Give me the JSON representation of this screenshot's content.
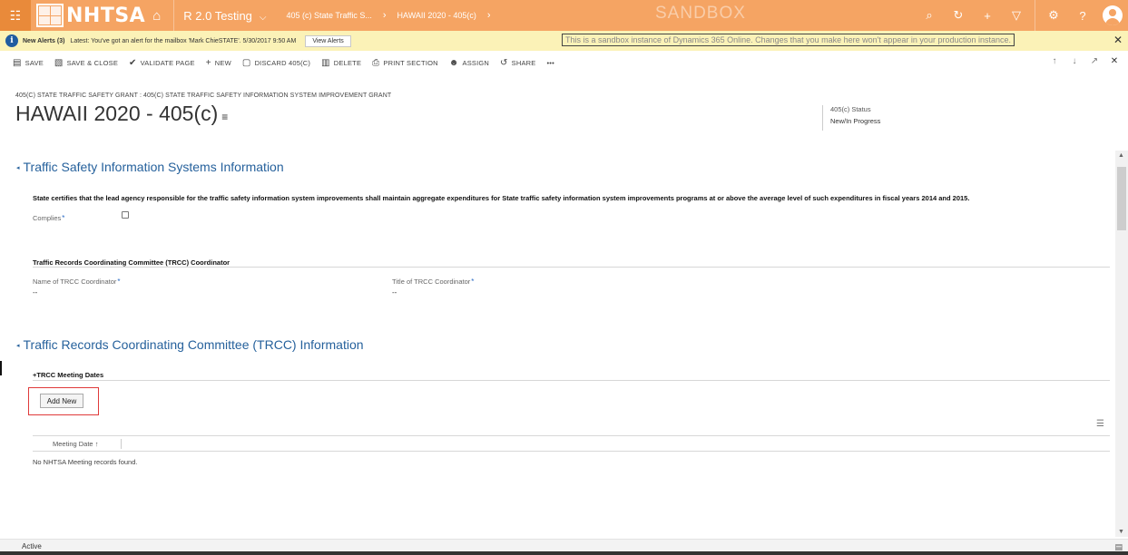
{
  "topnav": {
    "logo_text": "NHTSA",
    "environment": "R 2.0 Testing",
    "breadcrumb_1": "405 (c) State Traffic S...",
    "breadcrumb_2": "HAWAII 2020 - 405(c)",
    "sandbox_label": "SANDBOX"
  },
  "alert": {
    "title": "New Alerts (3)",
    "message": "Latest: You've got an alert for the mailbox 'Mark ChieSTATE'. 5/30/2017 9:50 AM",
    "view_label": "View Alerts",
    "sandbox_notice": "This is a sandbox instance of Dynamics 365 Online.  Changes that you make here won't appear in your production instance."
  },
  "commands": {
    "save": "SAVE",
    "save_close": "SAVE & CLOSE",
    "validate": "VALIDATE PAGE",
    "new": "NEW",
    "discard": "DISCARD 405(C)",
    "delete": "DELETE",
    "print": "PRINT SECTION",
    "assign": "ASSIGN",
    "share": "SHARE",
    "more": "•••"
  },
  "header": {
    "breadcrumb": "405(C) STATE TRAFFIC SAFETY GRANT : 405(C) STATE TRAFFIC SAFETY INFORMATION SYSTEM IMPROVEMENT GRANT",
    "title": "HAWAII 2020 - 405(c)",
    "status_label": "405(c) Status",
    "status_value": "New/In Progress"
  },
  "section1": {
    "title": "Traffic Safety Information Systems Information",
    "certification": "State certifies that the lead agency responsible for the traffic safety information system improvements shall maintain aggregate expenditures for State traffic safety information system improvements programs at or above the average level of such expenditures in fiscal years 2014 and 2015.",
    "complies_label": "Complies",
    "trcc_heading": "Traffic Records Coordinating Committee (TRCC) Coordinator",
    "name_label": "Name of TRCC Coordinator",
    "name_value": "--",
    "title_label": "Title of TRCC Coordinator",
    "title_value": "--"
  },
  "section2": {
    "title": "Traffic Records Coordinating Committee (TRCC) Information",
    "meeting_heading": "TRCC Meeting Dates",
    "add_new": "Add New",
    "col_meeting_date": "Meeting Date ↑",
    "no_records": "No NHTSA Meeting records found."
  },
  "footer": {
    "status": "Active"
  }
}
